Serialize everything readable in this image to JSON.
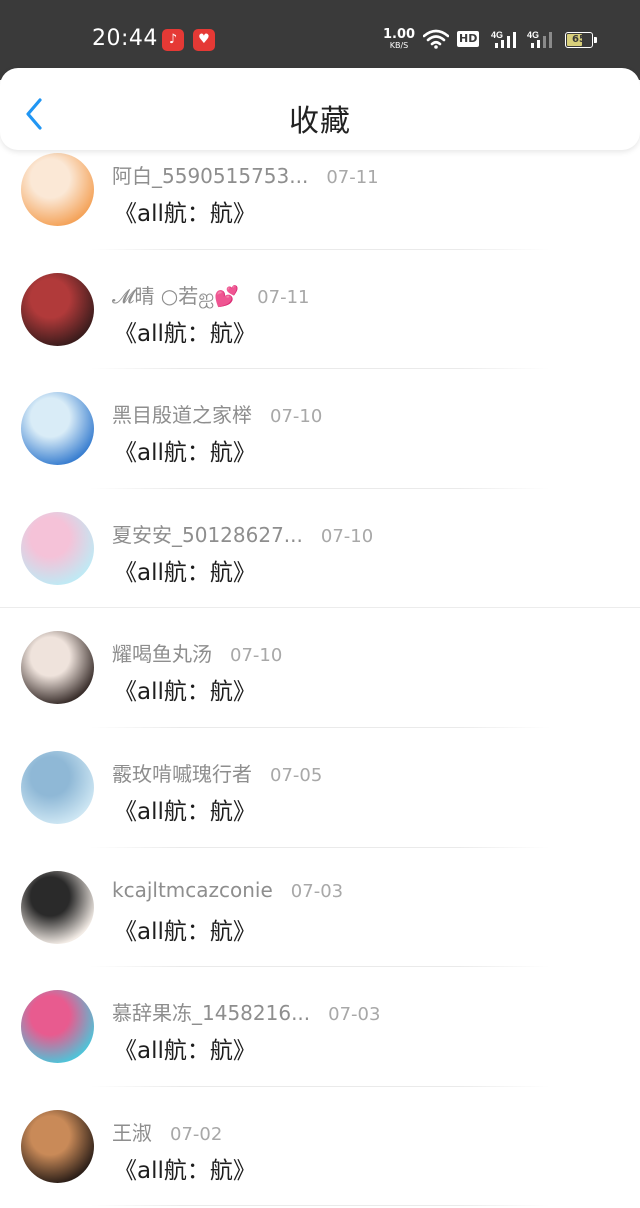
{
  "status_bar": {
    "time": "20:44",
    "net_speed_value": "1.00",
    "net_speed_unit": "KB/S",
    "hd_label": "HD",
    "signal_1_label": "4G",
    "signal_2_label": "4G",
    "battery_level": "65",
    "battery_fraction": 0.65,
    "app_icons": [
      "music-app-icon",
      "heart-app-icon"
    ]
  },
  "header": {
    "back_icon": "chevron-left-icon",
    "title": "收藏",
    "accent_color": "#2196f3"
  },
  "items": [
    {
      "user": "阿白_5590515753...",
      "date": "07-11",
      "title": "《all航：航》",
      "avatar_colors": [
        "#f4a35a",
        "#fbe8d6"
      ]
    },
    {
      "user": "𝓜晴 ○若ஐ💕",
      "date": "07-11",
      "title": "《all航：航》",
      "avatar_colors": [
        "#3b1c1c",
        "#b13a3a"
      ]
    },
    {
      "user": "黑目殷道之家榉",
      "date": "07-10",
      "title": "《all航：航》",
      "avatar_colors": [
        "#3a7fd0",
        "#d9ecf7"
      ]
    },
    {
      "user": "夏安安_50128627...",
      "date": "07-10",
      "title": "《all航：航》",
      "avatar_colors": [
        "#bfe9f4",
        "#f5c2d8"
      ]
    },
    {
      "user": "耀喝鱼丸汤",
      "date": "07-10",
      "title": "《all航：航》",
      "avatar_colors": [
        "#3a2f2c",
        "#efe3dc"
      ]
    },
    {
      "user": "霰玫啃嘁瑰行者",
      "date": "07-05",
      "title": "《all航：航》",
      "avatar_colors": [
        "#cde6f3",
        "#8fb8d6"
      ]
    },
    {
      "user": "kcajltmcazconie",
      "date": "07-03",
      "title": "《all航：航》",
      "avatar_colors": [
        "#f3ece6",
        "#2a2a2a"
      ]
    },
    {
      "user": "慕辞果冻_1458216...",
      "date": "07-03",
      "title": "《all航：航》",
      "avatar_colors": [
        "#4fc3d8",
        "#e85b8f"
      ]
    },
    {
      "user": "王淑",
      "date": "07-02",
      "title": "《all航：航》",
      "avatar_colors": [
        "#2c1f18",
        "#c98a58"
      ]
    }
  ]
}
